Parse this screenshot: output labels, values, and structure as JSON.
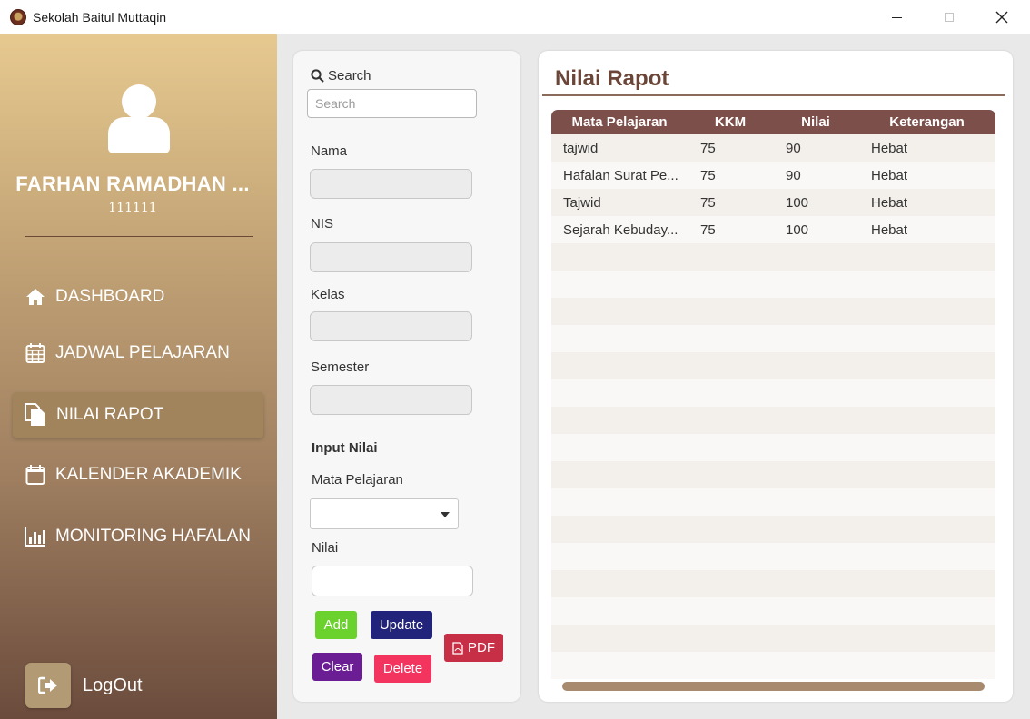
{
  "window": {
    "title": "Sekolah Baitul Muttaqin",
    "icons": [
      "school-logo-icon",
      "minimize-icon",
      "maximize-icon",
      "close-icon"
    ]
  },
  "sidebar": {
    "user_name": "FARHAN RAMADHAN ...",
    "user_nis": "111111",
    "items": [
      {
        "label": "DASHBOARD",
        "icon": "home-icon",
        "active": false
      },
      {
        "label": "JADWAL PELAJARAN",
        "icon": "calendar-grid-icon",
        "active": false
      },
      {
        "label": "NILAI RAPOT",
        "icon": "report-files-icon",
        "active": true
      },
      {
        "label": "KALENDER AKADEMIK",
        "icon": "calendar-icon",
        "active": false
      },
      {
        "label": "MONITORING HAFALAN",
        "icon": "bar-chart-icon",
        "active": false
      }
    ],
    "logout_label": "LogOut",
    "colors": {
      "top": "#e6c98f",
      "bottom": "#6b4b3c",
      "active": "#a0825a"
    }
  },
  "form": {
    "search_label": "Search",
    "search_placeholder": "Search",
    "fields": {
      "nama": {
        "label": "Nama",
        "value": ""
      },
      "nis": {
        "label": "NIS",
        "value": ""
      },
      "kelas": {
        "label": "Kelas",
        "value": ""
      },
      "semester": {
        "label": "Semester",
        "value": ""
      }
    },
    "input_section_title": "Input Nilai",
    "mata_pelajaran_label": "Mata Pelajaran",
    "mata_pelajaran_value": "",
    "nilai_label": "Nilai",
    "nilai_value": "",
    "buttons": {
      "add": "Add",
      "update": "Update",
      "pdf": "PDF",
      "clear": "Clear",
      "delete": "Delete"
    },
    "button_colors": {
      "add": "#6bd12c",
      "update": "#22237a",
      "pdf": "#c72f46",
      "clear": "#6b1d93",
      "delete": "#f2345f"
    }
  },
  "table": {
    "title": "Nilai Rapot",
    "columns": [
      "Mata Pelajaran",
      "KKM",
      "Nilai",
      "Keterangan"
    ],
    "rows": [
      [
        "tajwid",
        "75",
        "90",
        "Hebat"
      ],
      [
        "Hafalan Surat Pe...",
        "75",
        "90",
        "Hebat"
      ],
      [
        "Tajwid",
        "75",
        "100",
        "Hebat"
      ],
      [
        "Sejarah Kebuday...",
        "75",
        "100",
        "Hebat"
      ]
    ],
    "header_color": "#7d4f4b"
  }
}
